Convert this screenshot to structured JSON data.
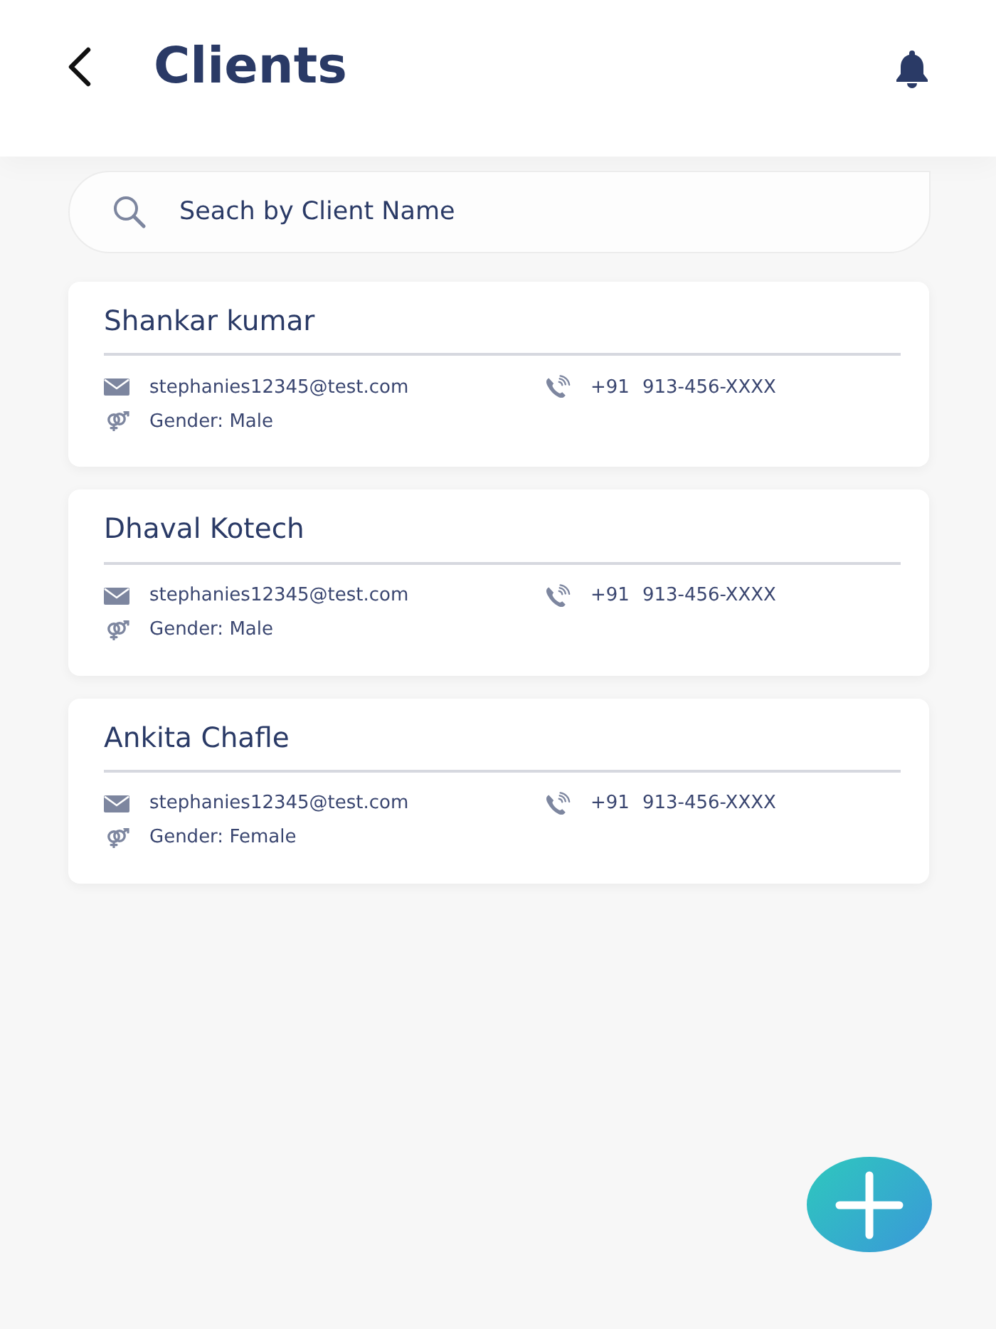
{
  "header": {
    "title": "Clients"
  },
  "search": {
    "placeholder": "Seach by Client Name"
  },
  "clients": [
    {
      "name": "Shankar kumar",
      "email": "stephanies12345@test.com",
      "phone_code": "+91",
      "phone": "913-456-XXXX",
      "gender": "Gender: Male"
    },
    {
      "name": "Dhaval Kotech",
      "email": "stephanies12345@test.com",
      "phone_code": "+91",
      "phone": "913-456-XXXX",
      "gender": "Gender: Male"
    },
    {
      "name": "Ankita Chafle",
      "email": "stephanies12345@test.com",
      "phone_code": "+91",
      "phone": "913-456-XXXX",
      "gender": "Gender: Female"
    }
  ]
}
